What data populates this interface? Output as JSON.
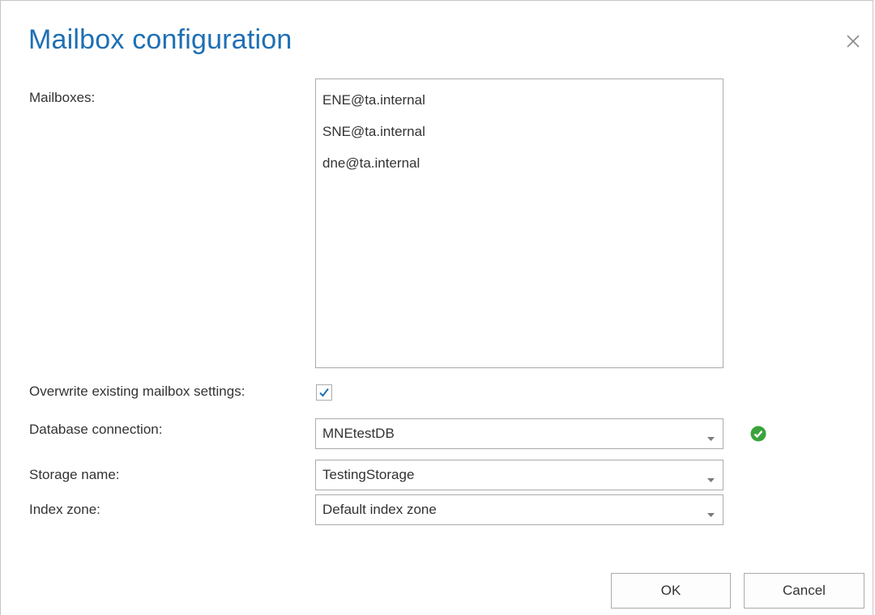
{
  "dialog": {
    "title": "Mailbox configuration",
    "close_icon": "close-icon"
  },
  "mailboxes": {
    "label": "Mailboxes:",
    "items": [
      "ENE@ta.internal",
      "SNE@ta.internal",
      "dne@ta.internal"
    ]
  },
  "overwrite": {
    "label": "Overwrite existing mailbox settings:",
    "checked": true
  },
  "database_connection": {
    "label": "Database connection:",
    "value": "MNEtestDB",
    "status_icon": "check-circle-icon",
    "status_color": "#3aa33a"
  },
  "storage_name": {
    "label": "Storage name:",
    "value": "TestingStorage"
  },
  "index_zone": {
    "label": "Index zone:",
    "value": "Default index zone"
  },
  "buttons": {
    "ok": "OK",
    "cancel": "Cancel"
  },
  "colors": {
    "title": "#1e6fb4",
    "checkmark": "#1e6fb4",
    "border": "#ababab"
  }
}
